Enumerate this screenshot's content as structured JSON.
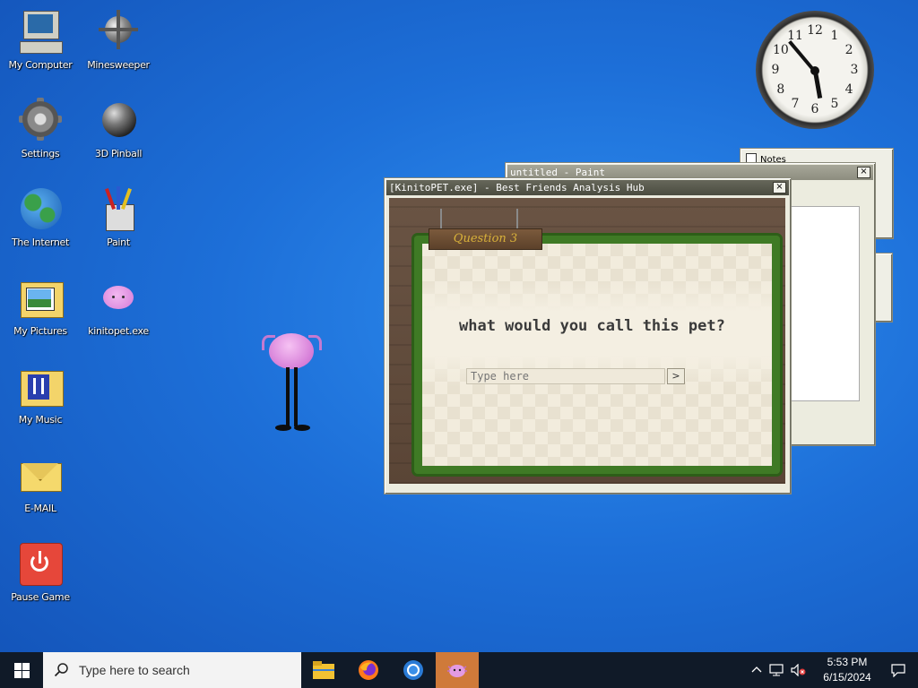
{
  "desktop_icons": [
    {
      "label": "My Computer"
    },
    {
      "label": "Minesweeper"
    },
    {
      "label": "Settings"
    },
    {
      "label": "3D Pinball"
    },
    {
      "label": "The Internet"
    },
    {
      "label": "Paint"
    },
    {
      "label": "My Pictures"
    },
    {
      "label": "kinitopet.exe"
    },
    {
      "label": "My Music"
    },
    {
      "label": "E-MAIL"
    },
    {
      "label": "Pause Game"
    }
  ],
  "analog_clock": {
    "numbers": [
      "12",
      "1",
      "2",
      "3",
      "4",
      "5",
      "6",
      "7",
      "8",
      "9",
      "10",
      "11"
    ]
  },
  "notes_window": {
    "title": "Notes"
  },
  "paint_window": {
    "title": "untitled - Paint",
    "close": "×"
  },
  "kinito_window": {
    "title": "[KinitoPET.exe] - Best Friends Analysis Hub",
    "close": "×",
    "question_label": "Question 3",
    "question_text": "what would you call this pet?",
    "answer_placeholder": "Type here",
    "submit_label": ">"
  },
  "taskbar": {
    "search_placeholder": "Type here to search",
    "time": "5:53 PM",
    "date": "6/15/2024"
  },
  "colors": {
    "desktop": "#1d6fd8",
    "titlebar": "#4b4c40",
    "vine": "#3f7a25",
    "wood": "#5a4536",
    "taskbar": "#101a28"
  }
}
